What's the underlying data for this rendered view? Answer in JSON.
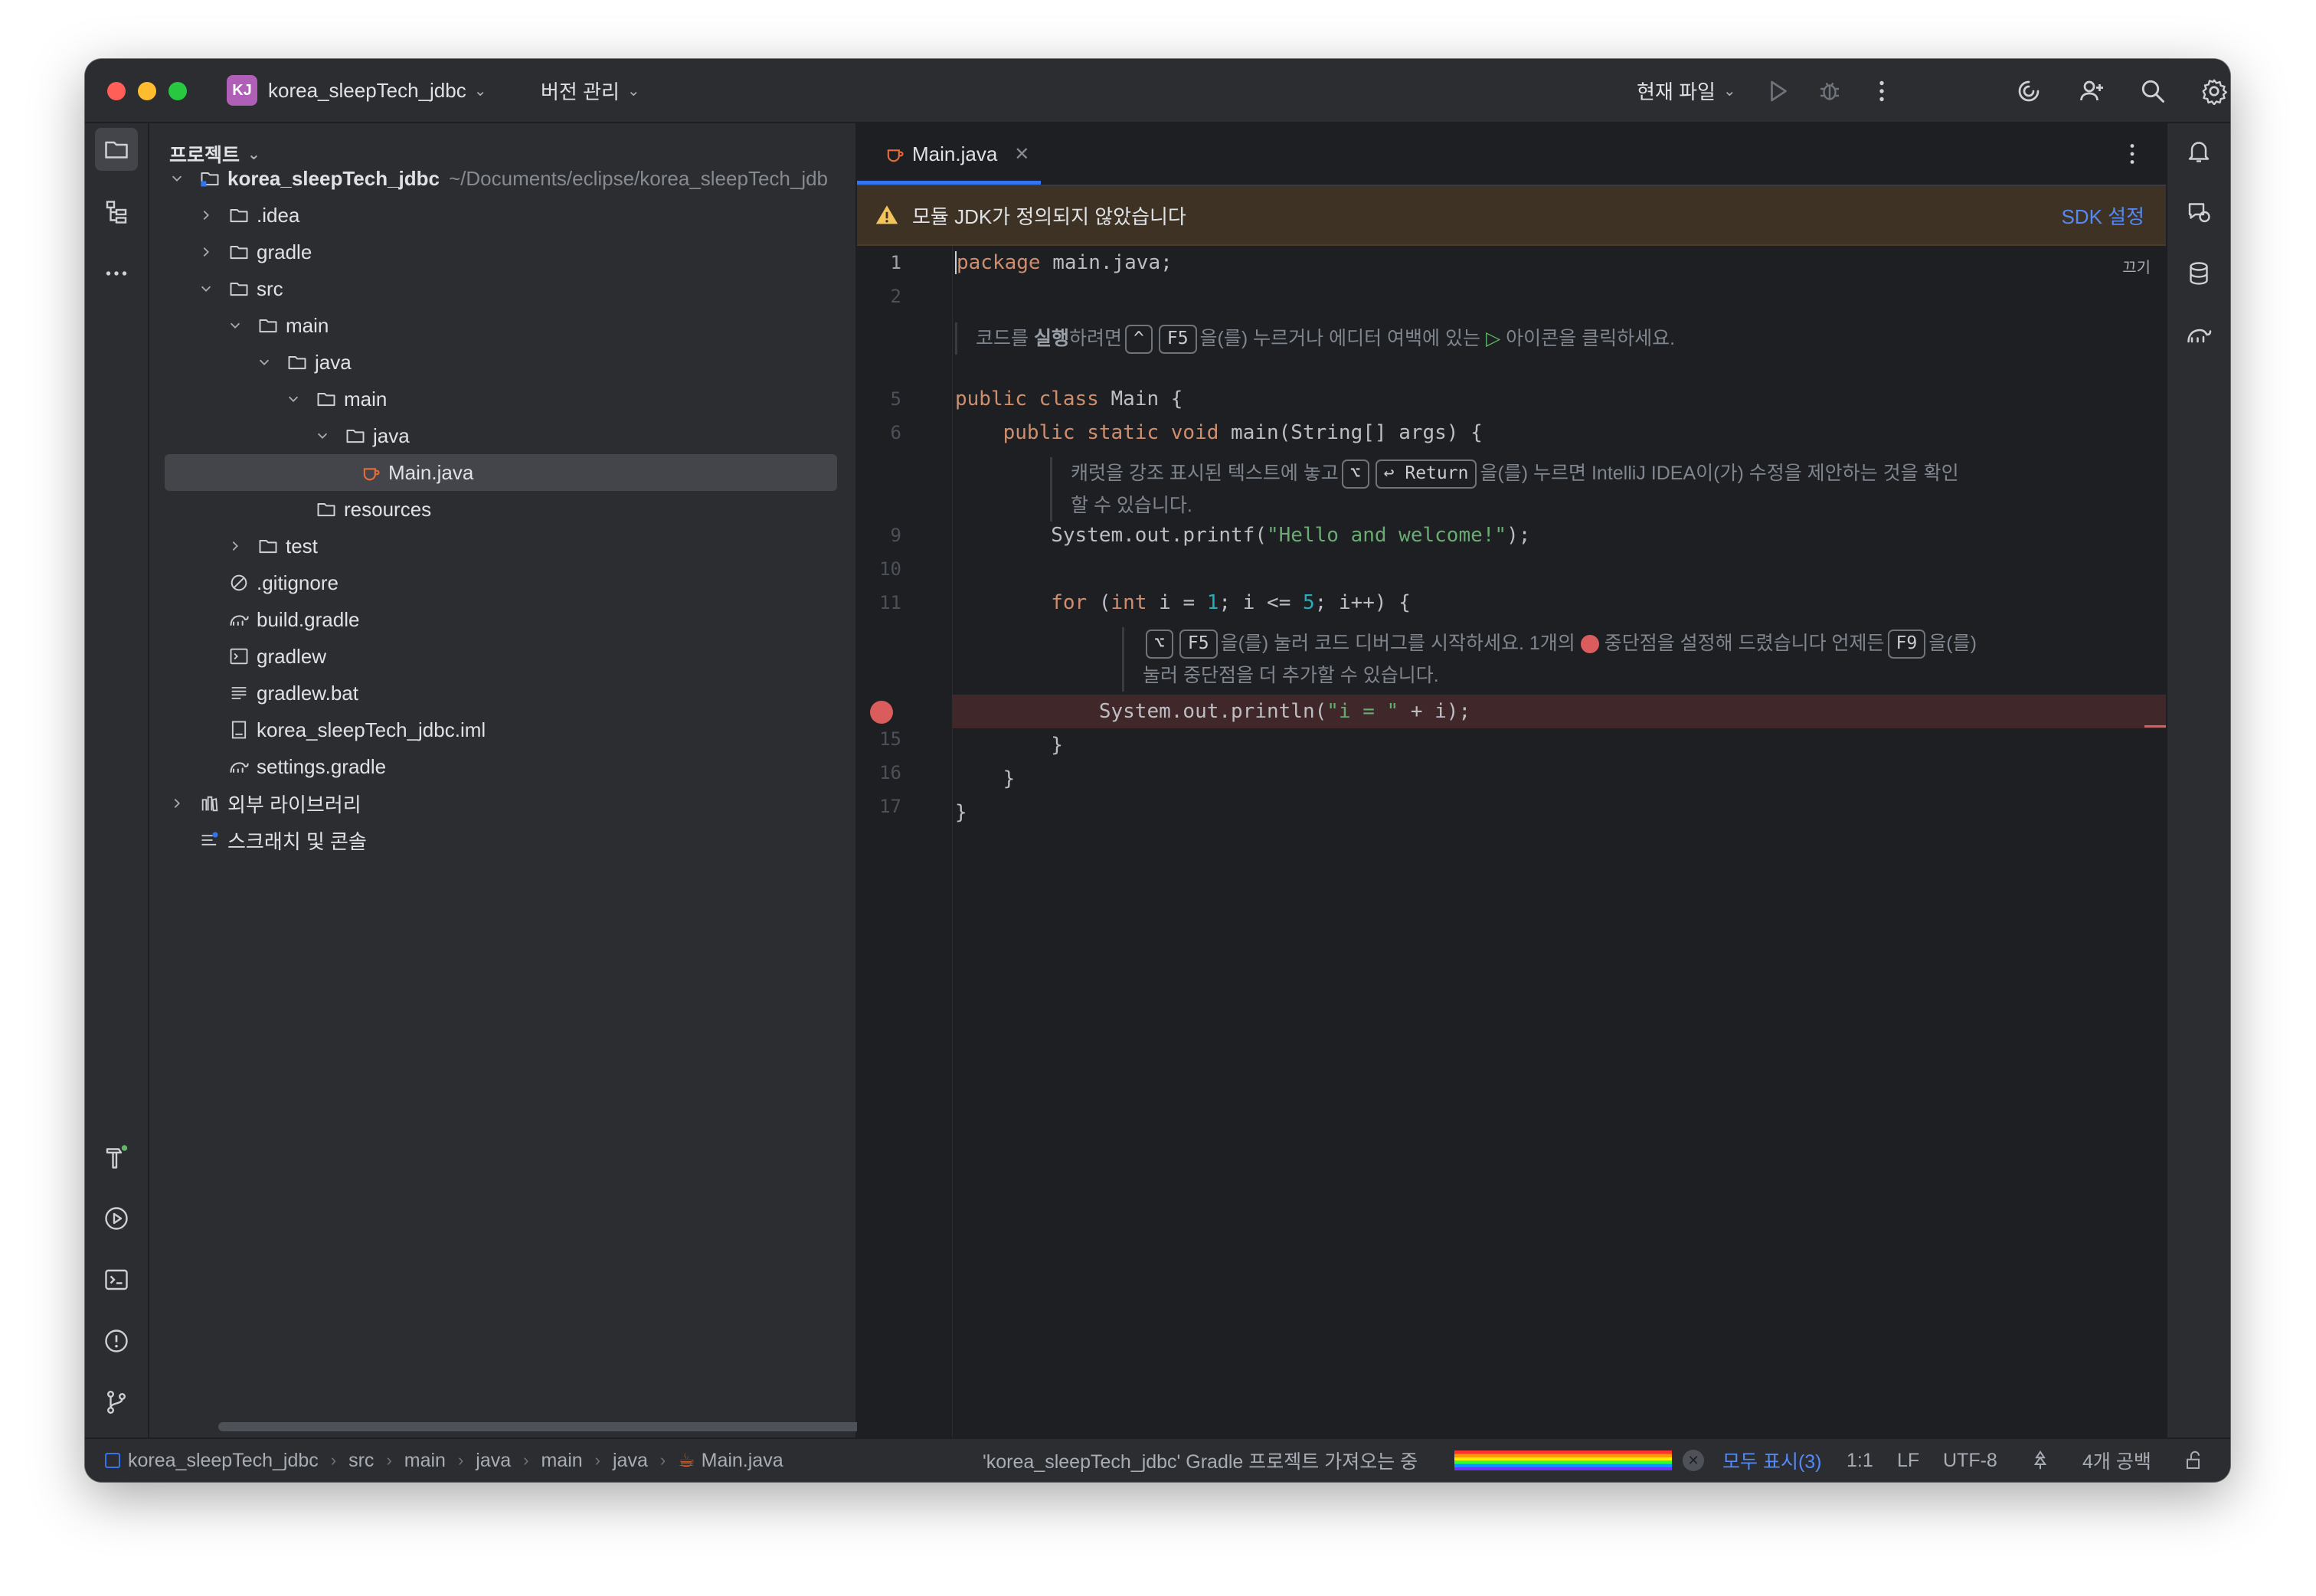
{
  "titlebar": {
    "project_badge": "KJ",
    "project_name": "korea_sleepTech_jdbc",
    "vcs_label": "버전 관리",
    "run_config": "현재 파일"
  },
  "project_panel": {
    "title": "프로젝트",
    "root_name": "korea_sleepTech_jdbc",
    "root_path": "~/Documents/eclipse/korea_sleepTech_jdb",
    "items": [
      {
        "label": ".idea"
      },
      {
        "label": "gradle"
      },
      {
        "label": "src"
      },
      {
        "label": "main"
      },
      {
        "label": "java"
      },
      {
        "label": "main"
      },
      {
        "label": "java"
      },
      {
        "label": "Main.java"
      },
      {
        "label": "resources"
      },
      {
        "label": "test"
      },
      {
        "label": ".gitignore"
      },
      {
        "label": "build.gradle"
      },
      {
        "label": "gradlew"
      },
      {
        "label": "gradlew.bat"
      },
      {
        "label": "korea_sleepTech_jdbc.iml"
      },
      {
        "label": "settings.gradle"
      },
      {
        "label": "외부 라이브러리"
      },
      {
        "label": "스크래치 및 콘솔"
      }
    ]
  },
  "editor": {
    "tab_label": "Main.java",
    "warning_text": "모듈 JDK가 정의되지 않았습니다",
    "warning_action": "SDK 설정",
    "reader_mode": "끄기",
    "line_numbers": [
      "1",
      "2",
      "5",
      "6",
      "9",
      "10",
      "11",
      "15",
      "16",
      "17"
    ],
    "code": {
      "l1_kw": "package",
      "l1_rest": " main.java;",
      "l5_kw": "public class",
      "l5_rest": " Main {",
      "l6_indent": "    ",
      "l6_kw": "public static void",
      "l6_rest": " main(String[] args) {",
      "l9_pre": "        System.out.printf(",
      "l9_str": "\"Hello and welcome!\"",
      "l9_post": ");",
      "l11_indent": "        ",
      "l11_kw1": "for",
      "l11_a": " (",
      "l11_kw2": "int",
      "l11_b": " i = ",
      "l11_n1": "1",
      "l11_c": "; i <= ",
      "l11_n2": "5",
      "l11_d": "; i++) {",
      "l14_pre": "            System.out.println(",
      "l14_str": "\"i = \"",
      "l14_post": " + i);",
      "l15": "        }",
      "l16": "    }",
      "l17": "}"
    },
    "hints": {
      "h1_a": "코드를 ",
      "h1_b": "실행",
      "h1_c": "하려면",
      "h1_key1": "^",
      "h1_key2": "F5",
      "h1_d": "을(를) 누르거나 에디터 여백에 있는",
      "h1_e": "아이콘을 클릭하세요.",
      "h2_a": "캐럿을 강조 표시된 텍스트에 놓고",
      "h2_key1": "⌥",
      "h2_key2": "↩ Return",
      "h2_b": "을(를) 누르면 IntelliJ IDEA이(가) 수정을 제안하는 것을 확인",
      "h2_c": "할 수 있습니다.",
      "h3_key1": "⌥",
      "h3_key2": "F5",
      "h3_a": "을(를) 눌러 코드 디버그를 시작하세요. 1개의",
      "h3_b": "중단점을 설정해 드렸습니다 언제든",
      "h3_key3": "F9",
      "h3_c": "을(를)",
      "h3_d": "눌러 중단점을 더 추가할 수 있습니다."
    }
  },
  "statusbar": {
    "breadcrumbs": [
      "korea_sleepTech_jdbc",
      "src",
      "main",
      "java",
      "main",
      "java",
      "Main.java"
    ],
    "task": "'korea_sleepTech_jdbc' Gradle 프로젝트 가져오는 중",
    "show_all": "모두 표시(3)",
    "position": "1:1",
    "line_sep": "LF",
    "encoding": "UTF-8",
    "indent": "4개 공백"
  },
  "colors": {
    "accent": "#3574f0",
    "breakpoint": "#db5c5c",
    "warning_bg": "#3d3223",
    "keyword": "#cf8e6d",
    "string": "#6aab73",
    "number": "#2aacb8"
  }
}
